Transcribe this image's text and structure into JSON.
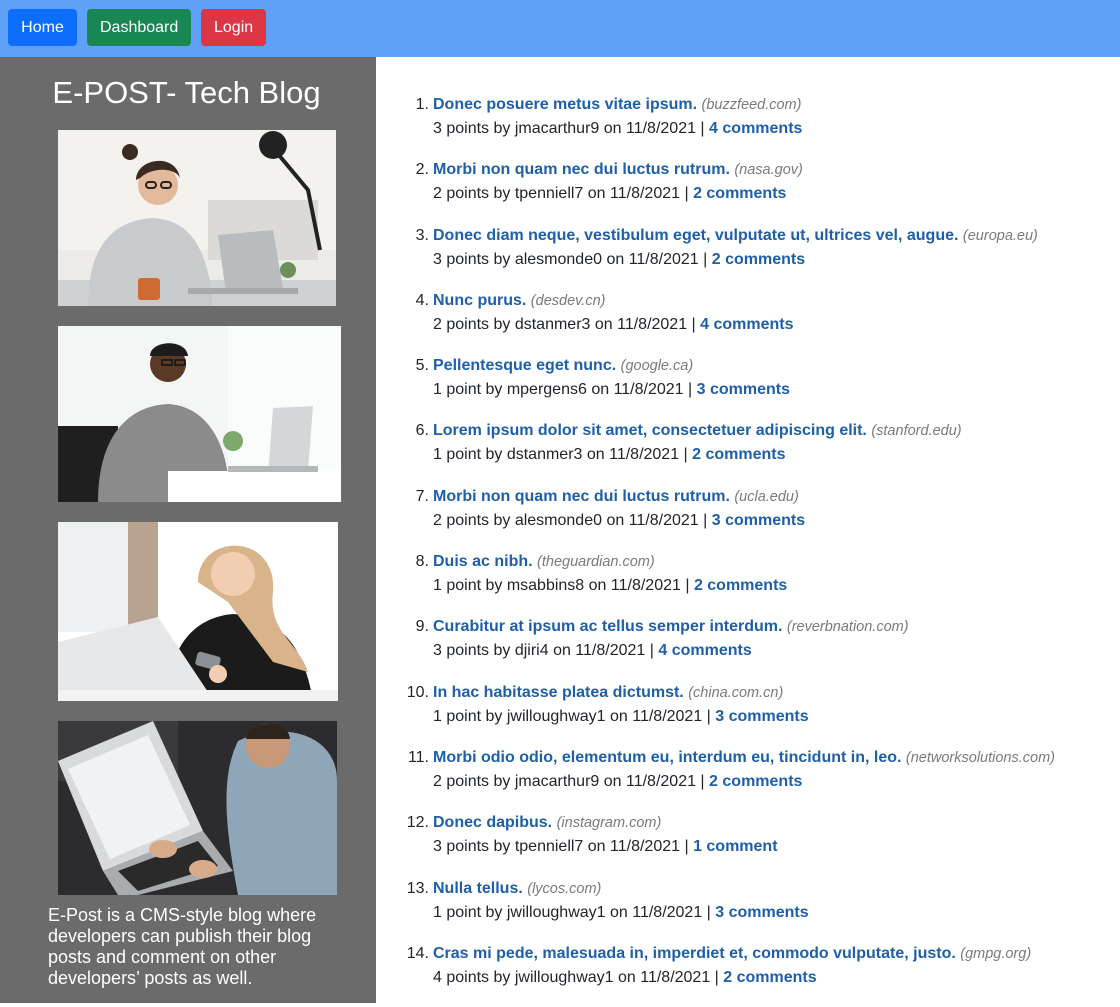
{
  "nav": {
    "home_label": "Home",
    "dashboard_label": "Dashboard",
    "login_label": "Login"
  },
  "sidebar": {
    "title": "E-POST- Tech Blog",
    "about": "E-Post is a CMS-style blog where developers can publish their blog posts and comment on other developers’ posts as well."
  },
  "colors": {
    "nav_bar": "#5ea1f7",
    "home_button": "#0d6efd",
    "dashboard_button": "#198754",
    "login_button": "#dc3545",
    "sidebar": "#6b6b6b",
    "link": "#1e5fa8"
  },
  "posts": [
    {
      "num": "1.",
      "title": "Donec posuere metus vitae ipsum.",
      "domain": "(buzzfeed.com)",
      "meta": "3 points by jmacarthur9 on 11/8/2021 |",
      "comments": "4 comments"
    },
    {
      "num": "2.",
      "title": "Morbi non quam nec dui luctus rutrum.",
      "domain": "(nasa.gov)",
      "meta": "2 points by tpenniell7 on 11/8/2021 |",
      "comments": "2 comments"
    },
    {
      "num": "3.",
      "title": "Donec diam neque, vestibulum eget, vulputate ut, ultrices vel, augue.",
      "domain": "(europa.eu)",
      "meta": "3 points by alesmonde0 on 11/8/2021 |",
      "comments": "2 comments"
    },
    {
      "num": "4.",
      "title": "Nunc purus.",
      "domain": "(desdev.cn)",
      "meta": "2 points by dstanmer3 on 11/8/2021 |",
      "comments": "4 comments"
    },
    {
      "num": "5.",
      "title": "Pellentesque eget nunc.",
      "domain": "(google.ca)",
      "meta": "1 point by mpergens6 on 11/8/2021 |",
      "comments": "3 comments"
    },
    {
      "num": "6.",
      "title": "Lorem ipsum dolor sit amet, consectetuer adipiscing elit.",
      "domain": "(stanford.edu)",
      "meta": "1 point by dstanmer3 on 11/8/2021 |",
      "comments": "2 comments"
    },
    {
      "num": "7.",
      "title": "Morbi non quam nec dui luctus rutrum.",
      "domain": "(ucla.edu)",
      "meta": "2 points by alesmonde0 on 11/8/2021 |",
      "comments": "3 comments"
    },
    {
      "num": "8.",
      "title": "Duis ac nibh.",
      "domain": "(theguardian.com)",
      "meta": "1 point by msabbins8 on 11/8/2021 |",
      "comments": "2 comments"
    },
    {
      "num": "9.",
      "title": "Curabitur at ipsum ac tellus semper interdum.",
      "domain": "(reverbnation.com)",
      "meta": "3 points by djiri4 on 11/8/2021 |",
      "comments": "4 comments"
    },
    {
      "num": "10.",
      "title": "In hac habitasse platea dictumst.",
      "domain": "(china.com.cn)",
      "meta": "1 point by jwilloughway1 on 11/8/2021 |",
      "comments": "3 comments"
    },
    {
      "num": "11.",
      "title": "Morbi odio odio, elementum eu, interdum eu, tincidunt in, leo.",
      "domain": "(networksolutions.com)",
      "meta": "2 points by jmacarthur9 on 11/8/2021 |",
      "comments": "2 comments"
    },
    {
      "num": "12.",
      "title": "Donec dapibus.",
      "domain": "(instagram.com)",
      "meta": "3 points by tpenniell7 on 11/8/2021 |",
      "comments": "1 comment"
    },
    {
      "num": "13.",
      "title": "Nulla tellus.",
      "domain": "(lycos.com)",
      "meta": "1 point by jwilloughway1 on 11/8/2021 |",
      "comments": "3 comments"
    },
    {
      "num": "14.",
      "title": "Cras mi pede, malesuada in, imperdiet et, commodo vulputate, justo.",
      "domain": "(gmpg.org)",
      "meta": "4 points by jwilloughway1 on 11/8/2021 |",
      "comments": "2 comments"
    }
  ]
}
